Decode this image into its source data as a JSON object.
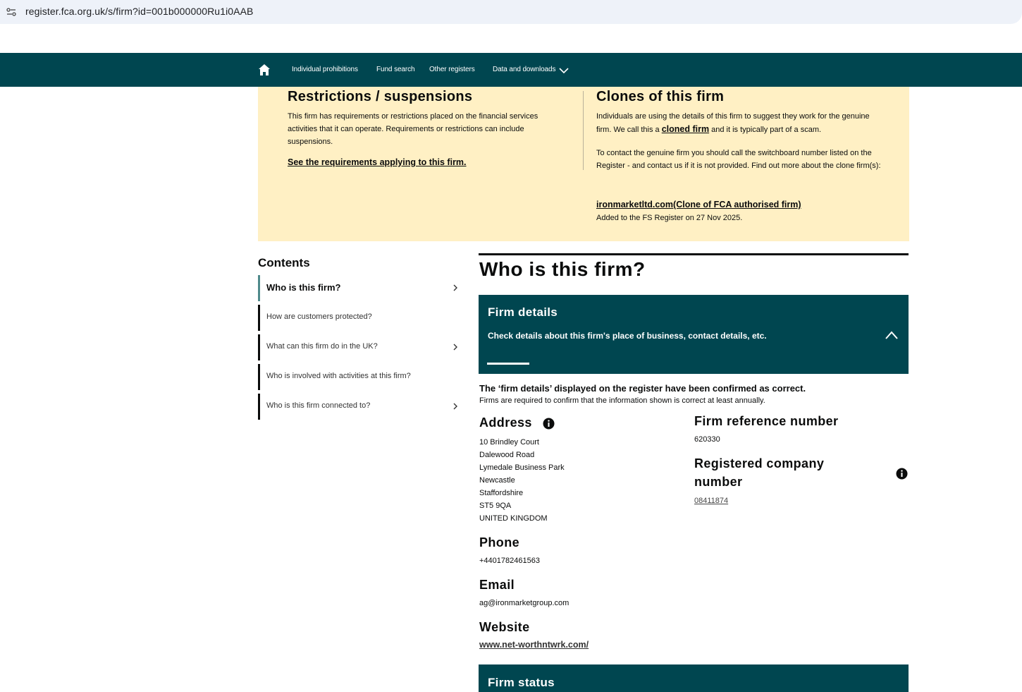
{
  "browser": {
    "url": "register.fca.org.uk/s/firm?id=001b000000Ru1i0AAB"
  },
  "nav": {
    "items": [
      "Individual prohibitions",
      "Fund search",
      "Other registers",
      "Data and downloads"
    ]
  },
  "warning": {
    "restrictions": {
      "title": "Restrictions / suspensions",
      "body": "This firm has requirements or restrictions placed on the financial services activities that it can operate. Requirements or restrictions can include suspensions.",
      "link": "See the requirements applying to this firm."
    },
    "clones": {
      "title": "Clones of this firm",
      "body_pre": "Individuals are using the details of this firm to suggest they work for the genuine firm. We call this a ",
      "body_link": "cloned firm",
      "body_post": " and it is typically part of a scam.",
      "contact": "To contact the genuine firm you should call the switchboard number listed on the Register - and contact us if it is not provided. Find out more about the clone firm(s):",
      "clone_link": "ironmarketltd.com(Clone of FCA authorised firm)",
      "added": "Added to the FS Register on 27 Nov 2025."
    }
  },
  "contents": {
    "title": "Contents",
    "items": [
      {
        "label": "Who is this firm?",
        "active": true,
        "arrow": true
      },
      {
        "label": "How are customers protected?",
        "active": false,
        "arrow": false
      },
      {
        "label": "What can this firm do in the UK?",
        "active": false,
        "arrow": true
      },
      {
        "label": "Who is involved with activities at this firm?",
        "active": false,
        "arrow": false
      },
      {
        "label": "Who is this firm connected to?",
        "active": false,
        "arrow": true
      }
    ]
  },
  "main": {
    "title": "Who is this firm?",
    "firm_details": {
      "title": "Firm details",
      "desc": "Check details about this firm's place of business, contact details, etc."
    },
    "confirmed": "The ‘firm details’ displayed on the register have been confirmed as correct.",
    "confirmed_sub": "Firms are required to confirm that the information shown is correct at least annually.",
    "address": {
      "label": "Address",
      "lines": [
        "10 Brindley Court",
        "Dalewood Road",
        "Lymedale Business Park",
        "Newcastle",
        "Staffordshire",
        "ST5 9QA",
        "UNITED KINGDOM"
      ]
    },
    "phone": {
      "label": "Phone",
      "value": "+4401782461563"
    },
    "email": {
      "label": "Email",
      "value": "ag@ironmarketgroup.com"
    },
    "website": {
      "label": "Website",
      "value": "www.net-worthntwrk.com/"
    },
    "frn": {
      "label": "Firm reference number",
      "value": "620330"
    },
    "company": {
      "label_line1": "Registered company",
      "label_line2": "number",
      "value": "08411874"
    },
    "firm_status": {
      "title": "Firm status"
    }
  },
  "colors": {
    "nav_bg": "#004650",
    "warning_bg": "#fff0c4",
    "active_toc": "#4f8a8b"
  }
}
